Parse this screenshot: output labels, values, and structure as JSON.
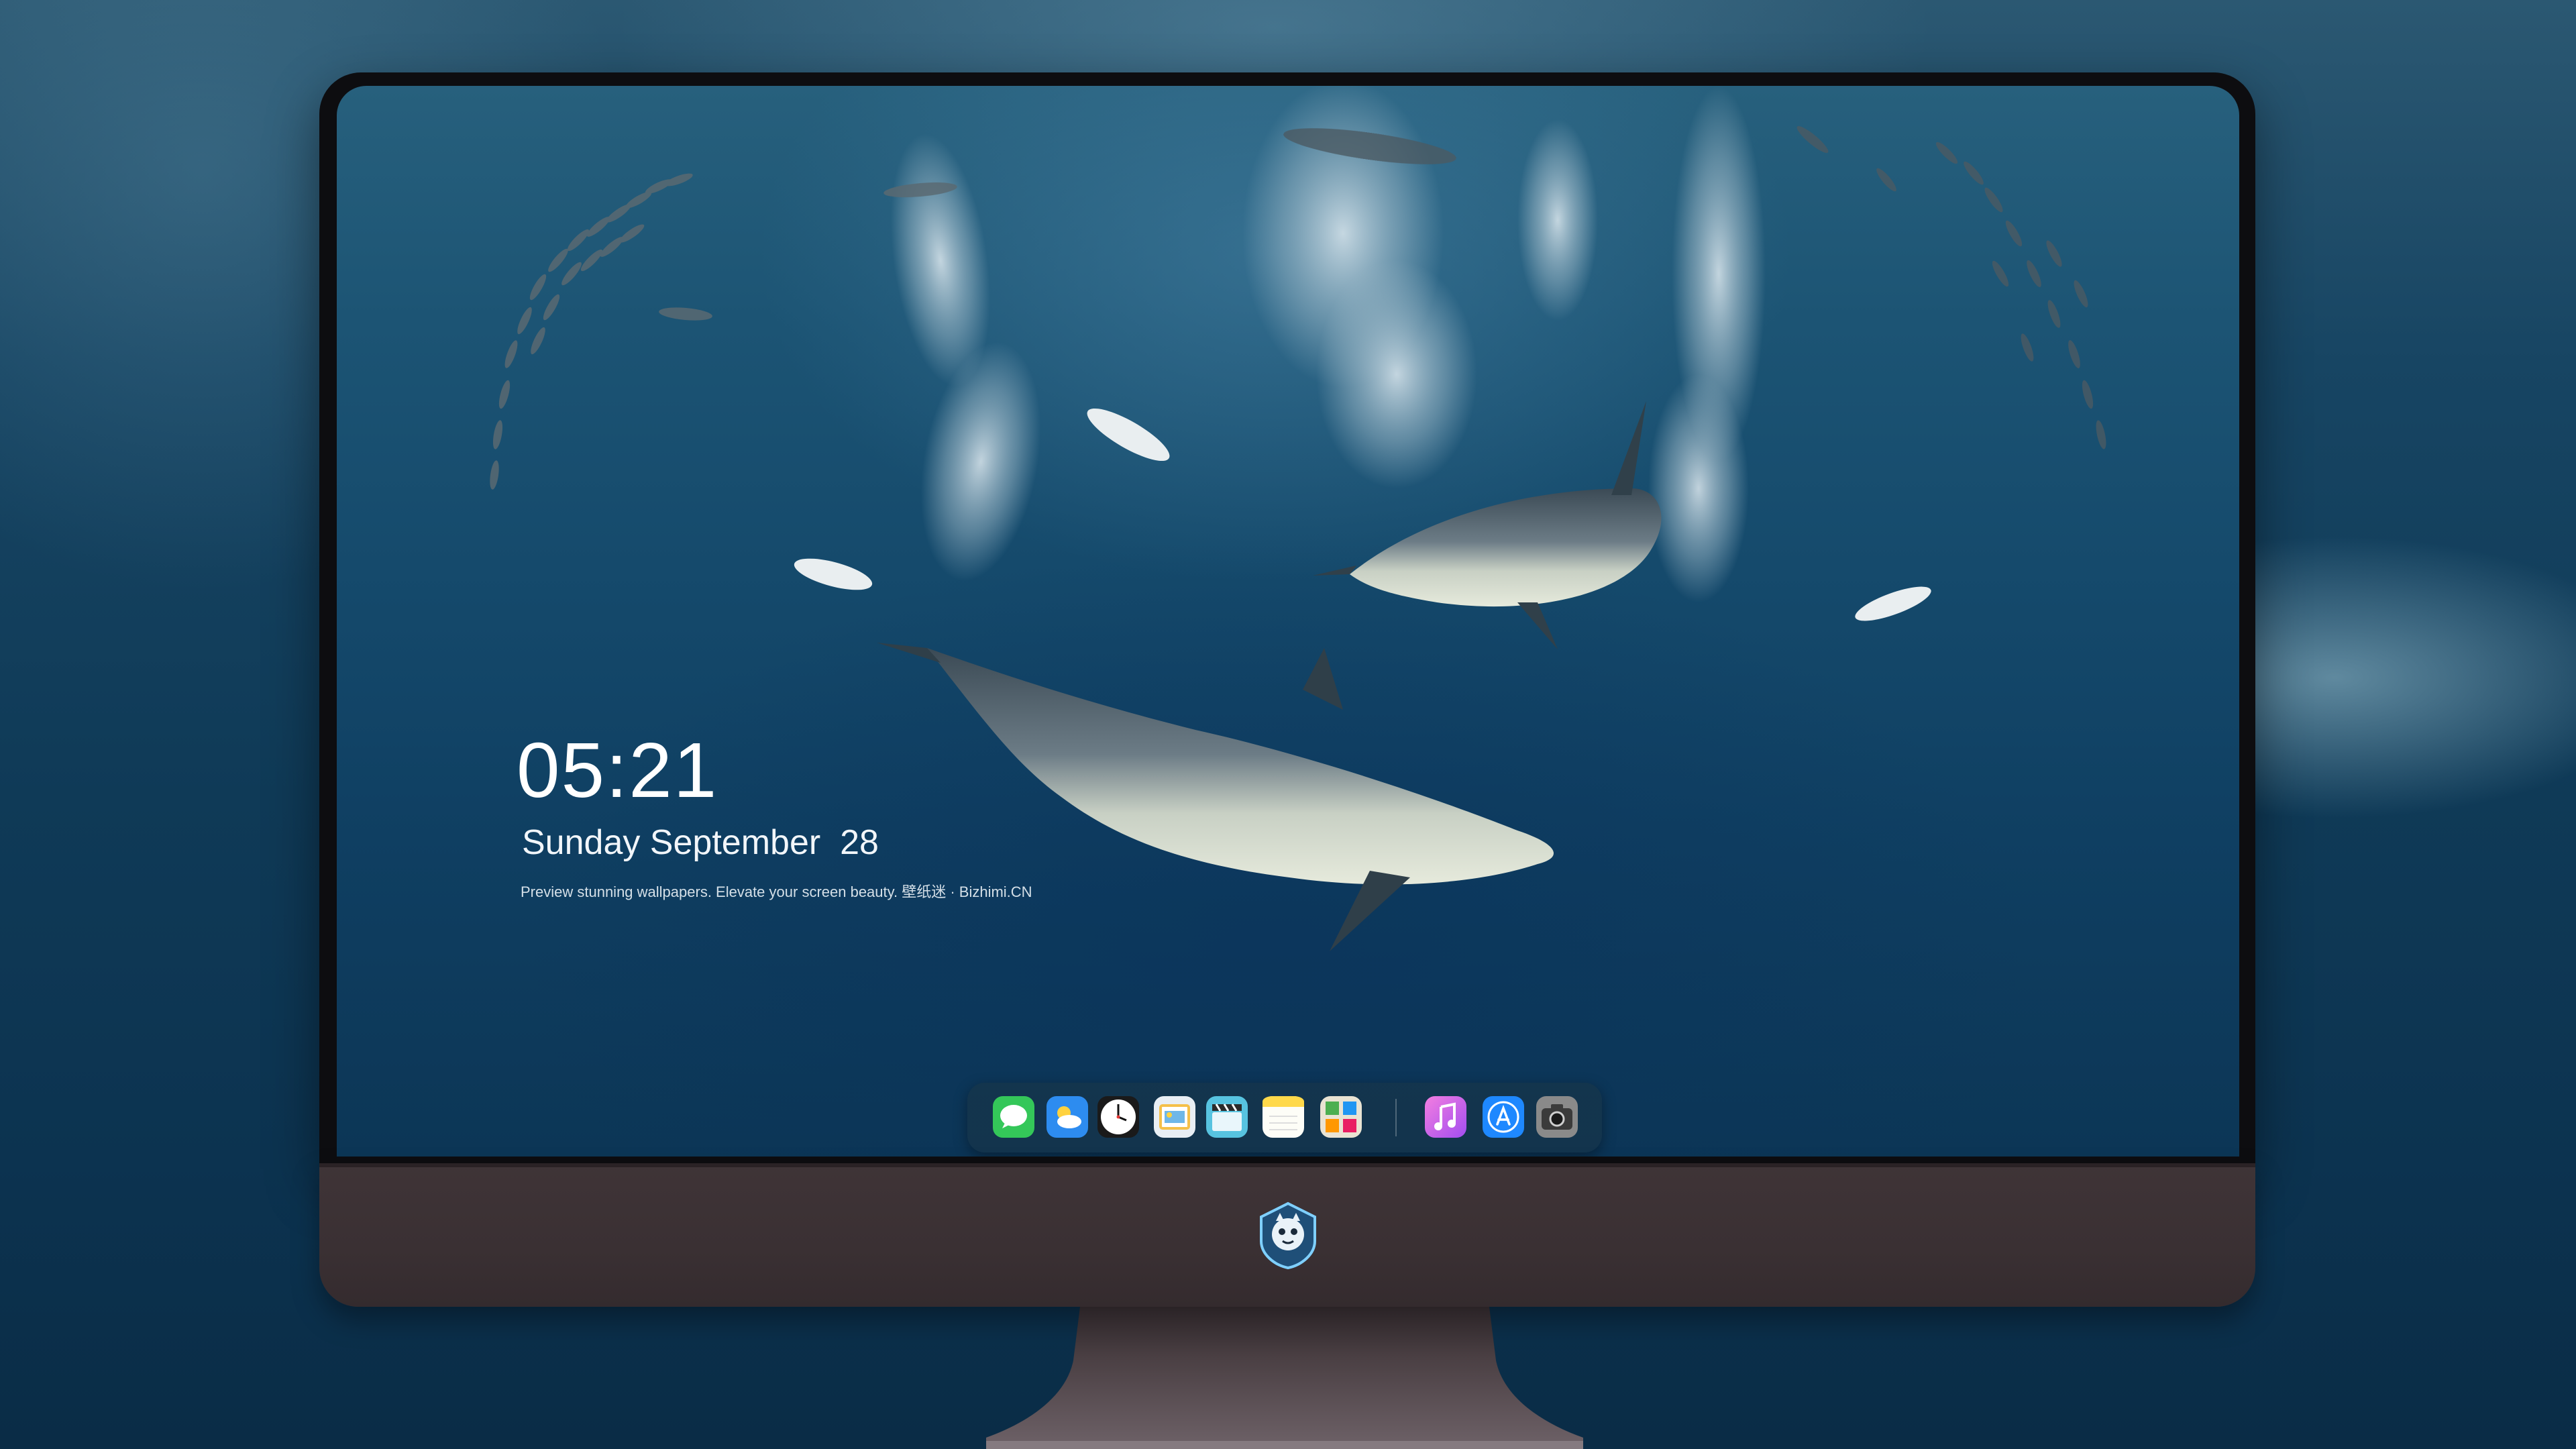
{
  "lockscreen": {
    "time": "05:21",
    "date": "Sunday September  28",
    "caption": "Preview stunning wallpapers. Elevate your screen beauty. 壁纸迷 · Bizhimi.CN"
  },
  "dock": {
    "apps": [
      {
        "name": "Messages",
        "icon": "messages-icon",
        "color": "#34c759"
      },
      {
        "name": "Weather",
        "icon": "weather-icon",
        "color": "#2d8cf0"
      },
      {
        "name": "Clock",
        "icon": "clock-icon",
        "color": "#ffffff"
      },
      {
        "name": "Preview",
        "icon": "preview-icon",
        "color": "#f5c04a"
      },
      {
        "name": "Clips",
        "icon": "clapperboard-icon",
        "color": "#57c3e0"
      },
      {
        "name": "Notes",
        "icon": "notes-icon",
        "color": "#ffd94a"
      },
      {
        "name": "Photos",
        "icon": "photos-icon",
        "color": "#e9e3d3"
      },
      {
        "name": "Music",
        "icon": "music-icon",
        "color": "#d46cf0"
      },
      {
        "name": "App Store",
        "icon": "app-store-icon",
        "color": "#1e88ff"
      },
      {
        "name": "Camera",
        "icon": "camera-icon",
        "color": "#7b7b7b"
      }
    ]
  },
  "monitor": {
    "logo": "shield-mascot-logo",
    "body_color": "#3c3235",
    "bezel_color": "#0d0d10"
  }
}
